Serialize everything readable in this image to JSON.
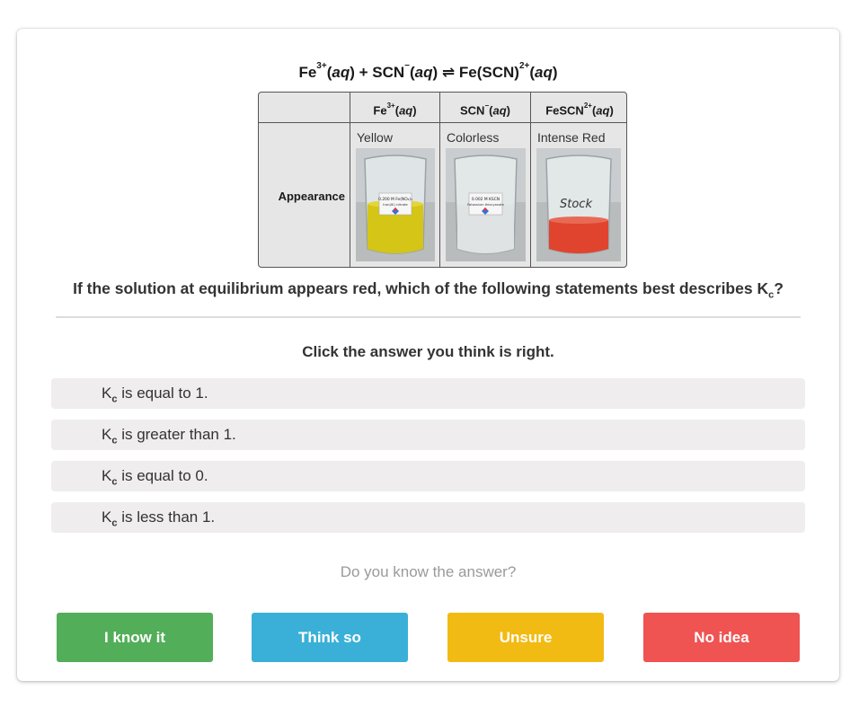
{
  "equation": {
    "fe": "Fe",
    "fe_charge": "3+",
    "scn": "SCN",
    "scn_charge": "−",
    "plus": " + ",
    "arrow": " ⇌ ",
    "product": "Fe(SCN)",
    "product_charge": "2+",
    "aq": "aq"
  },
  "table": {
    "headers": [
      {
        "species": "Fe",
        "charge": "3+",
        "state": "aq"
      },
      {
        "species": "SCN",
        "charge": "−",
        "state": "aq"
      },
      {
        "species": "FeSCN",
        "charge": "2+",
        "state": "aq"
      }
    ],
    "row_label": "Appearance",
    "colors": [
      "Yellow",
      "Colorless",
      "Intense Red"
    ],
    "beakers": [
      {
        "label_line1": "0.200 M Fe(NO₃)₃",
        "label_line2": "Iron(III) nitrate",
        "liquid": "#d4c516"
      },
      {
        "label_line1": "0.002 M KSCN",
        "label_line2": "Potassium thiocyanate",
        "liquid": "#dfe3e3"
      },
      {
        "label_line1": "Stock",
        "label_line2": "",
        "liquid": "#e0442e"
      }
    ]
  },
  "question": {
    "text": "If the solution at equilibrium appears red, which of the following statements best describes K",
    "sub": "c",
    "end": "?"
  },
  "instruction": "Click the answer you think is right.",
  "options": [
    {
      "k": "K",
      "sub": "c",
      "text": " is equal to 1."
    },
    {
      "k": "K",
      "sub": "c",
      "text": " is greater than 1."
    },
    {
      "k": "K",
      "sub": "c",
      "text": " is equal to 0."
    },
    {
      "k": "K",
      "sub": "c",
      "text": " is less than 1."
    }
  ],
  "confidence": {
    "prompt": "Do you know the answer?",
    "buttons": [
      {
        "label": "I know it",
        "color": "#52ae58"
      },
      {
        "label": "Think so",
        "color": "#3ab0d8"
      },
      {
        "label": "Unsure",
        "color": "#f2bb14"
      },
      {
        "label": "No idea",
        "color": "#ef5352"
      }
    ]
  }
}
